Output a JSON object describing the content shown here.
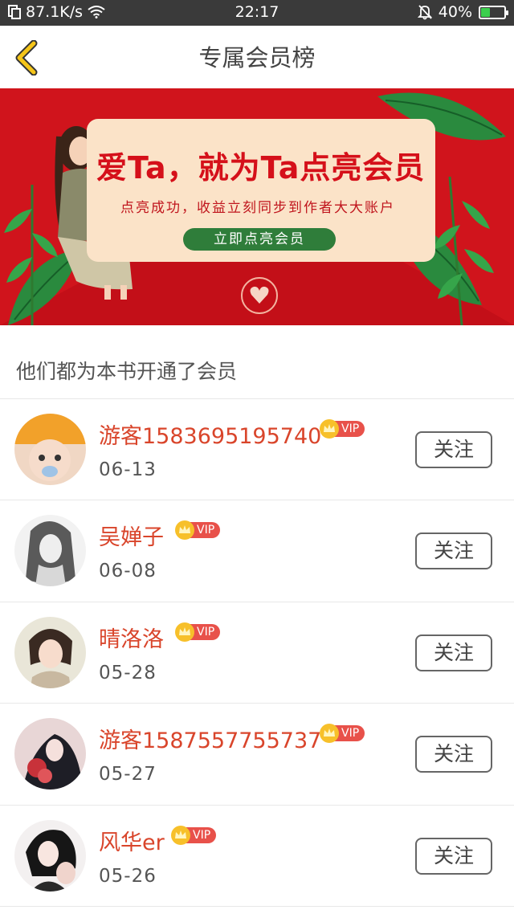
{
  "status_bar": {
    "speed": "87.1K/s",
    "time": "22:17",
    "battery": "40%",
    "battery_level": 0.4
  },
  "nav": {
    "title": "专属会员榜"
  },
  "banner": {
    "title": "爱Ta，就为Ta点亮会员",
    "subtitle": "点亮成功，收益立刻同步到作者大大账户",
    "button": "立即点亮会员",
    "colors": {
      "background": "#d0141c",
      "card": "#fbe3c8",
      "button": "#2f7d3a"
    }
  },
  "section_header": "他们都为本书开通了会员",
  "vip_label": "VIP",
  "follow_label": "关注",
  "members": [
    {
      "name": "游客1583695195740",
      "date": "06-13"
    },
    {
      "name": "吴婵子",
      "date": "06-08"
    },
    {
      "name": "晴洛洛",
      "date": "05-28"
    },
    {
      "name": "游客1587557755737",
      "date": "05-27"
    },
    {
      "name": "风华er",
      "date": "05-26"
    }
  ]
}
